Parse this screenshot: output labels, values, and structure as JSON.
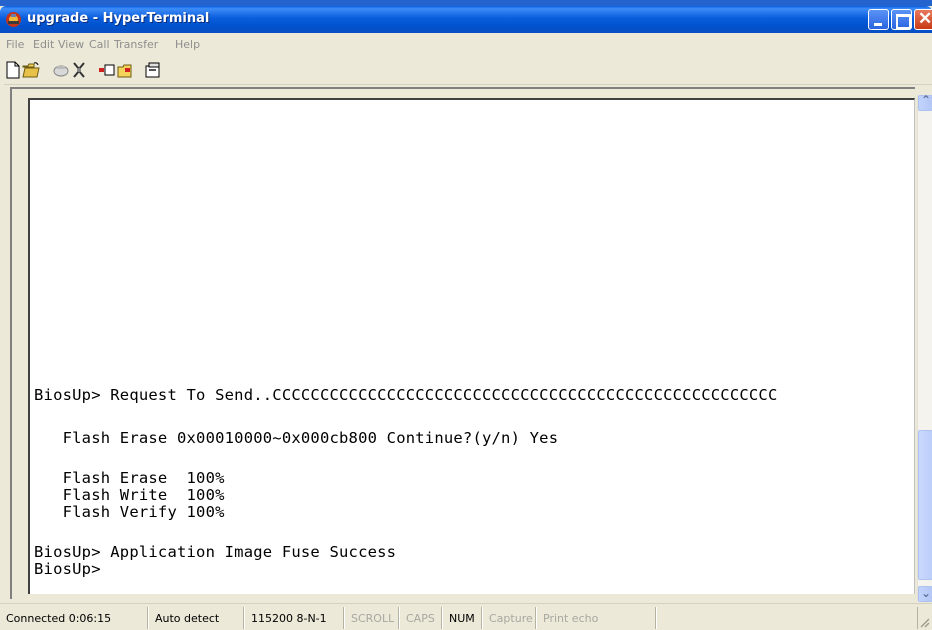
{
  "window": {
    "title": "upgrade - HyperTerminal",
    "titlebar_color": "#0a5ddc",
    "icons": [
      "hyperterminal-app-icon",
      "minimize-icon",
      "maximize-icon",
      "close-icon"
    ]
  },
  "menu": {
    "items": [
      "File",
      "Edit",
      "View",
      "Call",
      "Transfer",
      "Help"
    ]
  },
  "toolbar": {
    "icons": [
      "new-icon",
      "open-icon",
      "call-icon",
      "disconnect-icon",
      "send-icon",
      "receive-icon",
      "properties-icon"
    ]
  },
  "terminal": {
    "lines": [
      "BiosUp> Request To Send..CCCCCCCCCCCCCCCCCCCCCCCCCCCCCCCCCCCCCCCCCCCCCCCCCCCCC",
      "   Flash Erase 0x00010000~0x000cb800 Continue?(y/n) Yes",
      "   Flash Erase  100%",
      "   Flash Write  100%",
      "   Flash Verify 100%",
      "BiosUp> Application Image Fuse Success",
      "BiosUp>"
    ]
  },
  "statusbar": {
    "connection": "Connected 0:06:15",
    "detect": "Auto detect",
    "settings": "115200 8-N-1",
    "scroll": "SCROLL",
    "caps": "CAPS",
    "num": "NUM",
    "capture": "Capture",
    "print_echo": "Print echo"
  }
}
